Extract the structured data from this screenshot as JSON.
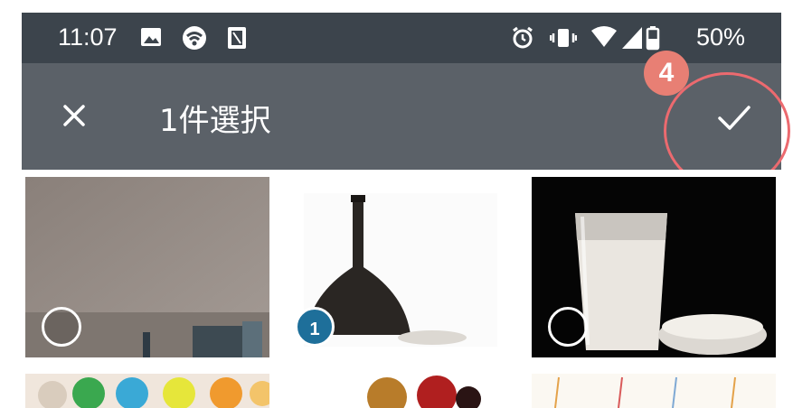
{
  "status_bar": {
    "time": "11:07",
    "battery": "50%",
    "icons": [
      "image-icon",
      "wifi-hotspot-icon",
      "nfc-icon",
      "alarm-icon",
      "vibrate-icon",
      "wifi-icon",
      "signal-icon",
      "battery-icon"
    ]
  },
  "app_bar": {
    "title": "1件選択",
    "close_icon": "close-icon",
    "confirm_icon": "check-icon"
  },
  "annotation": {
    "step": "4",
    "color": "#ec6a6f"
  },
  "photos": [
    {
      "subject": "room-wall",
      "selected": false
    },
    {
      "subject": "dark-bottle",
      "selected": true,
      "order": "1"
    },
    {
      "subject": "glass-of-milk",
      "selected": false
    },
    {
      "subject": "colorful-fruit",
      "selected": false
    },
    {
      "subject": "red-candy",
      "selected": false
    },
    {
      "subject": "light-pattern",
      "selected": false
    }
  ],
  "colors": {
    "status_bar": "#3c444c",
    "app_bar": "#5b6168",
    "selection_badge": "#1e6f9a"
  }
}
